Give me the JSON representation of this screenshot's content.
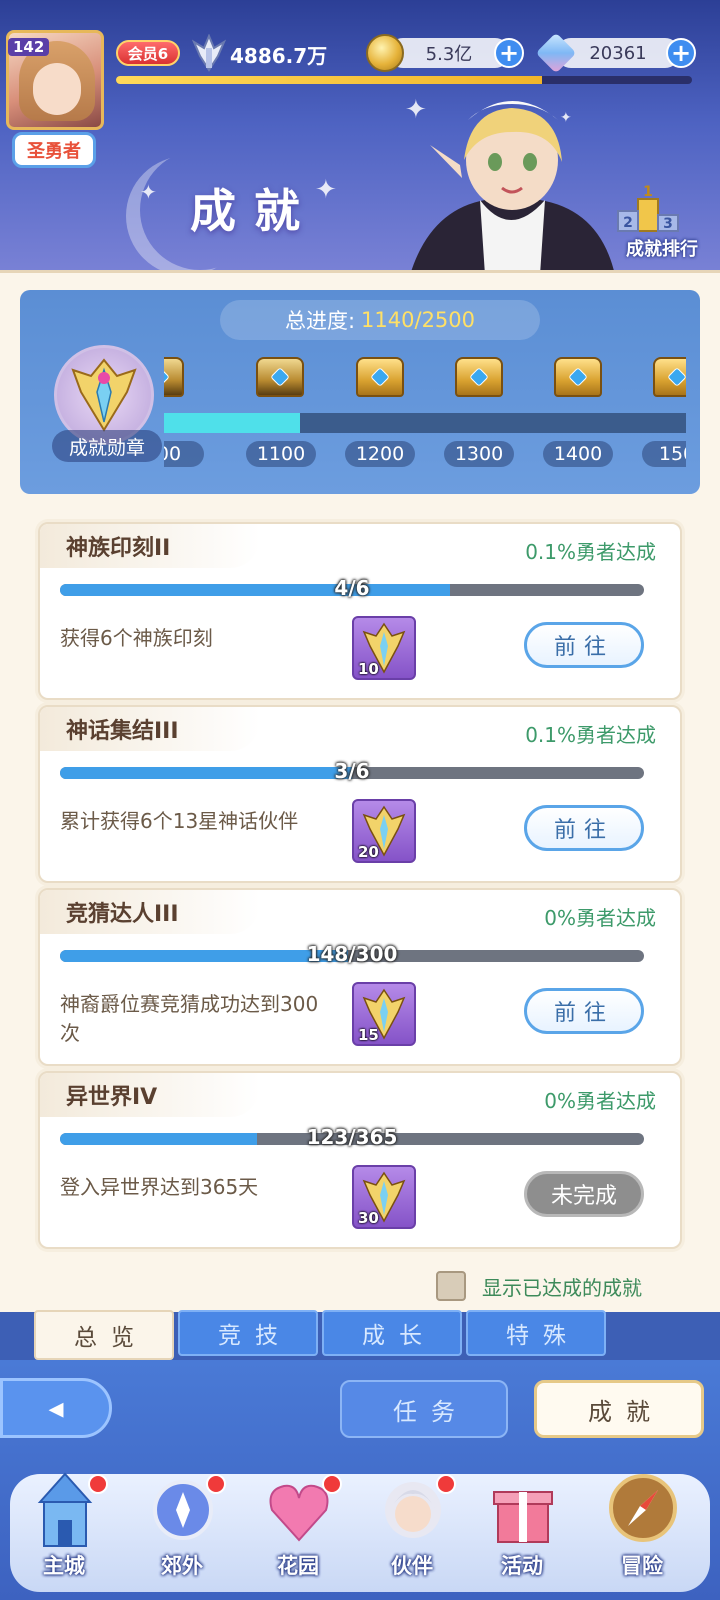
{
  "player": {
    "level": "142",
    "title": "圣勇者",
    "vip": "会员6",
    "power": "4886.7万",
    "exp_fraction": 0.74
  },
  "currencies": {
    "gold": "5.3亿",
    "diamonds": "20361"
  },
  "page": {
    "title": "成就",
    "ranking_label": "成就排行",
    "ranking_digits": [
      "1",
      "2",
      "3"
    ]
  },
  "progress": {
    "label": "总进度:",
    "value": "1140/2500",
    "medal_label": "成就勋章",
    "milestones": [
      "00",
      "1100",
      "1200",
      "1300",
      "1400",
      "150"
    ],
    "bar_fraction": 0.26
  },
  "achievements": [
    {
      "title": "神族印刻II",
      "rate": "0.1%勇者达成",
      "progress": "4/6",
      "fraction": 0.667,
      "desc": "获得6个神族印刻",
      "reward_count": "10",
      "action": "前往",
      "done": false
    },
    {
      "title": "神话集结III",
      "rate": "0.1%勇者达成",
      "progress": "3/6",
      "fraction": 0.5,
      "desc": "累计获得6个13星神话伙伴",
      "reward_count": "20",
      "action": "前往",
      "done": false
    },
    {
      "title": "竞猜达人III",
      "rate": "0%勇者达成",
      "progress": "148/300",
      "fraction": 0.493,
      "desc": "神裔爵位赛竞猜成功达到300次",
      "reward_count": "15",
      "action": "前往",
      "done": false
    },
    {
      "title": "异世界IV",
      "rate": "0%勇者达成",
      "progress": "123/365",
      "fraction": 0.337,
      "desc": "登入异世界达到365天",
      "reward_count": "30",
      "action": "未完成",
      "done": true
    }
  ],
  "show_completed_label": "显示已达成的成就",
  "tabs": [
    "总览",
    "竞技",
    "成长",
    "特殊"
  ],
  "sub_tabs": [
    "任务",
    "成就"
  ],
  "nav": [
    "主城",
    "郊外",
    "花园",
    "伙伴",
    "活动",
    "冒险"
  ],
  "colors": {
    "accent_blue": "#3f9ee8",
    "rate_green": "#3d9a6a",
    "vip_red": "#d93232"
  }
}
